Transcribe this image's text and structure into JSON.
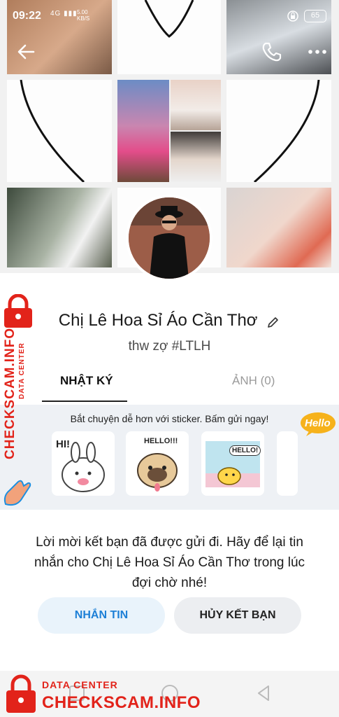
{
  "status_bar": {
    "time": "09:22",
    "signal": "4G",
    "speed_value": "5.00",
    "speed_unit": "KB/S",
    "battery": "65"
  },
  "profile": {
    "name": "Chị Lê Hoa Sỉ Áo Cần Thơ",
    "status": "thw zợ #LTLH"
  },
  "tabs": [
    {
      "label": "NHẬT KÝ",
      "active": true
    },
    {
      "label": "ẢNH (0)",
      "active": false
    }
  ],
  "stickers": {
    "title": "Bắt chuyện dễ hơn với sticker. Bấm gửi ngay!",
    "badge": "Hello",
    "items": [
      {
        "caption": "HI!"
      },
      {
        "caption": "HELLO!!!"
      },
      {
        "caption": "HELLO!"
      }
    ]
  },
  "invite": {
    "text": "Lời mời kết bạn đã được gửi đi. Hãy để lại tin nhắn cho Chị Lê Hoa Sỉ Áo Cần Thơ trong lúc đợi chờ nhé!"
  },
  "actions": {
    "message_label": "NHẮN TIN",
    "unfriend_label": "HỦY KẾT BẠN"
  },
  "watermark": {
    "line1": "DATA CENTER",
    "line2": "CHECKSCAM.INFO"
  },
  "icons": [
    "back-arrow-icon",
    "phone-icon",
    "more-icon",
    "pencil-icon",
    "lock-icon",
    "recent-apps-icon",
    "home-icon",
    "back-nav-icon"
  ],
  "colors": {
    "accent": "#1d7fd6",
    "watermark": "#e2231a",
    "sticker_bg": "#eef1f5"
  }
}
